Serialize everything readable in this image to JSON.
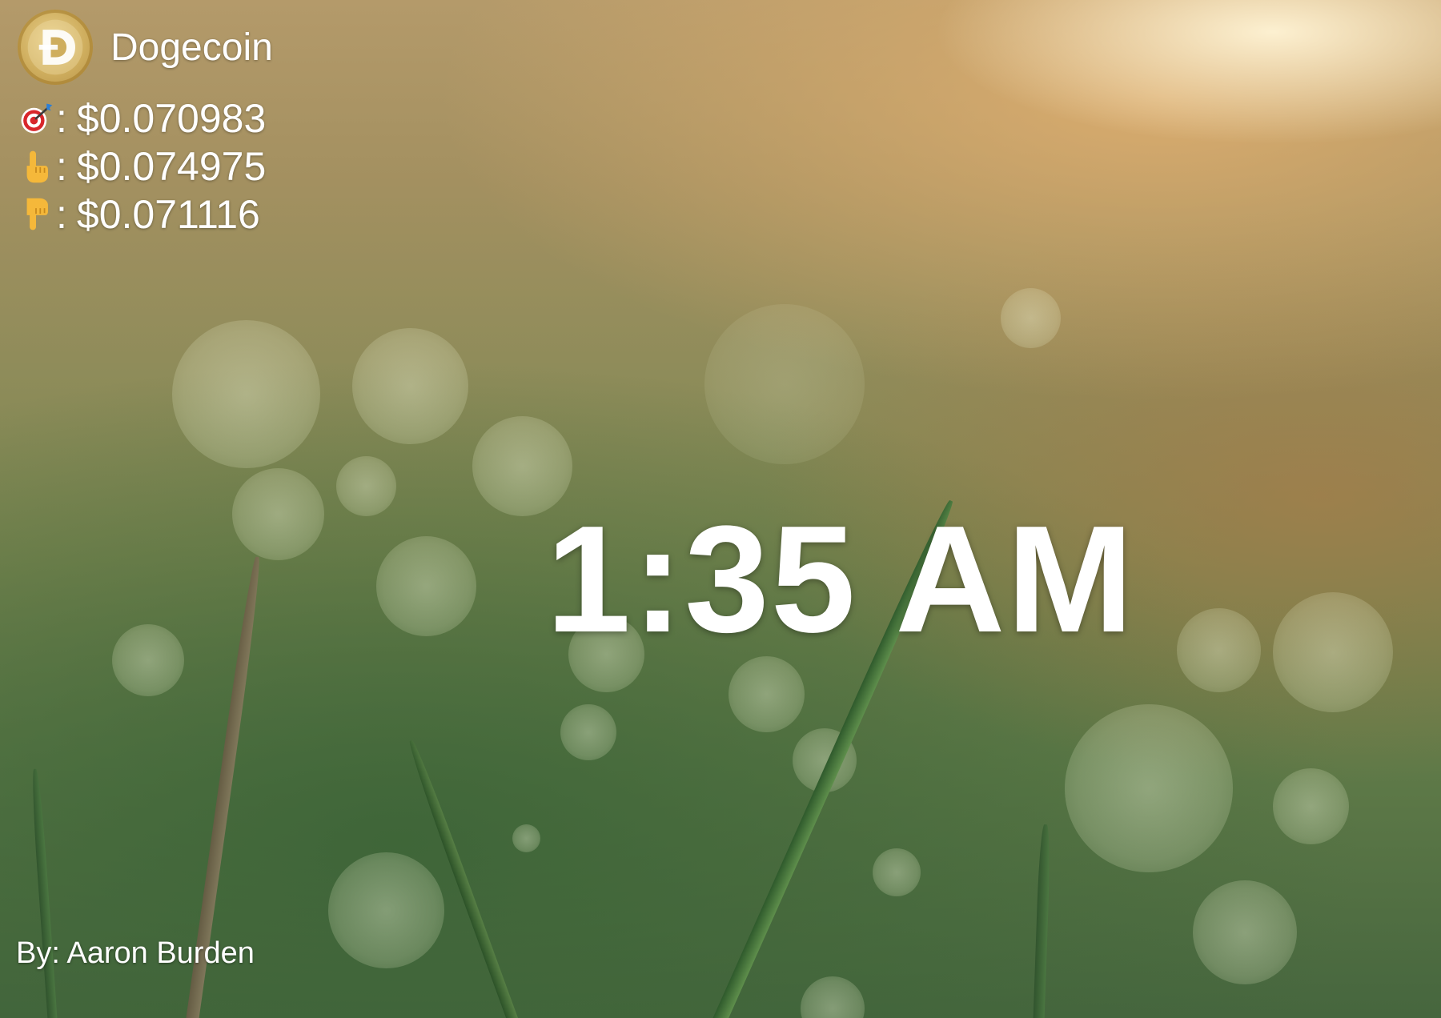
{
  "coin": {
    "name": "Dogecoin",
    "logo_icon": "dogecoin-logo-icon",
    "logo_color": "#cfae5e"
  },
  "prices": [
    {
      "icon": "target-dart-icon",
      "separator": ":",
      "value": "$0.070983"
    },
    {
      "icon": "pointing-up-hand-icon",
      "separator": ":",
      "value": "$0.074975"
    },
    {
      "icon": "pointing-down-hand-icon",
      "separator": ":",
      "value": "$0.071116"
    }
  ],
  "clock": {
    "time": "1:35 AM"
  },
  "photo": {
    "credit": "By: Aaron Burden"
  },
  "colors": {
    "text": "#ffffff"
  }
}
